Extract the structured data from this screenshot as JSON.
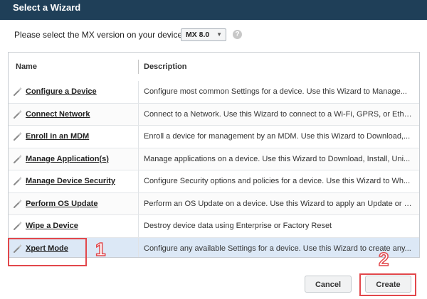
{
  "window": {
    "title": "Select a Wizard"
  },
  "mx": {
    "label": "Please select the MX version on your device:",
    "selected": "MX 8.0",
    "help_glyph": "?"
  },
  "table": {
    "headers": {
      "name": "Name",
      "description": "Description"
    },
    "rows": [
      {
        "name": "Configure a Device",
        "description": "Configure most common Settings for a device. Use this Wizard to Manage..."
      },
      {
        "name": "Connect Network",
        "description": "Connect to a Network. Use this Wizard to connect to a Wi-Fi, GPRS, or Ether..."
      },
      {
        "name": "Enroll in an MDM",
        "description": "Enroll a device for management by an MDM.  Use this Wizard to Download,..."
      },
      {
        "name": "Manage Application(s)",
        "description": "Manage applications on a device.  Use this Wizard to Download, Install, Uni..."
      },
      {
        "name": "Manage Device Security",
        "description": "Configure Security options and policies for a device.  Use this Wizard to Wh..."
      },
      {
        "name": "Perform OS Update",
        "description": "Perform an OS Update on a device.  Use this Wizard to apply an Update or a..."
      },
      {
        "name": "Wipe a Device",
        "description": "Destroy device data using Enterprise or Factory Reset"
      },
      {
        "name": "Xpert Mode",
        "description": "Configure any available Settings for a device. Use this Wizard to create any..."
      }
    ],
    "selected_index": 7
  },
  "annotations": {
    "step1": "1",
    "step2": "2",
    "highlight_color": "#e2474b"
  },
  "buttons": {
    "cancel": "Cancel",
    "create": "Create"
  },
  "icons": {
    "row_icon": "magic-wand-icon",
    "help": "help-circle-icon"
  },
  "colors": {
    "titlebar": "#1f3f58",
    "selected_row": "#dce8f6"
  }
}
